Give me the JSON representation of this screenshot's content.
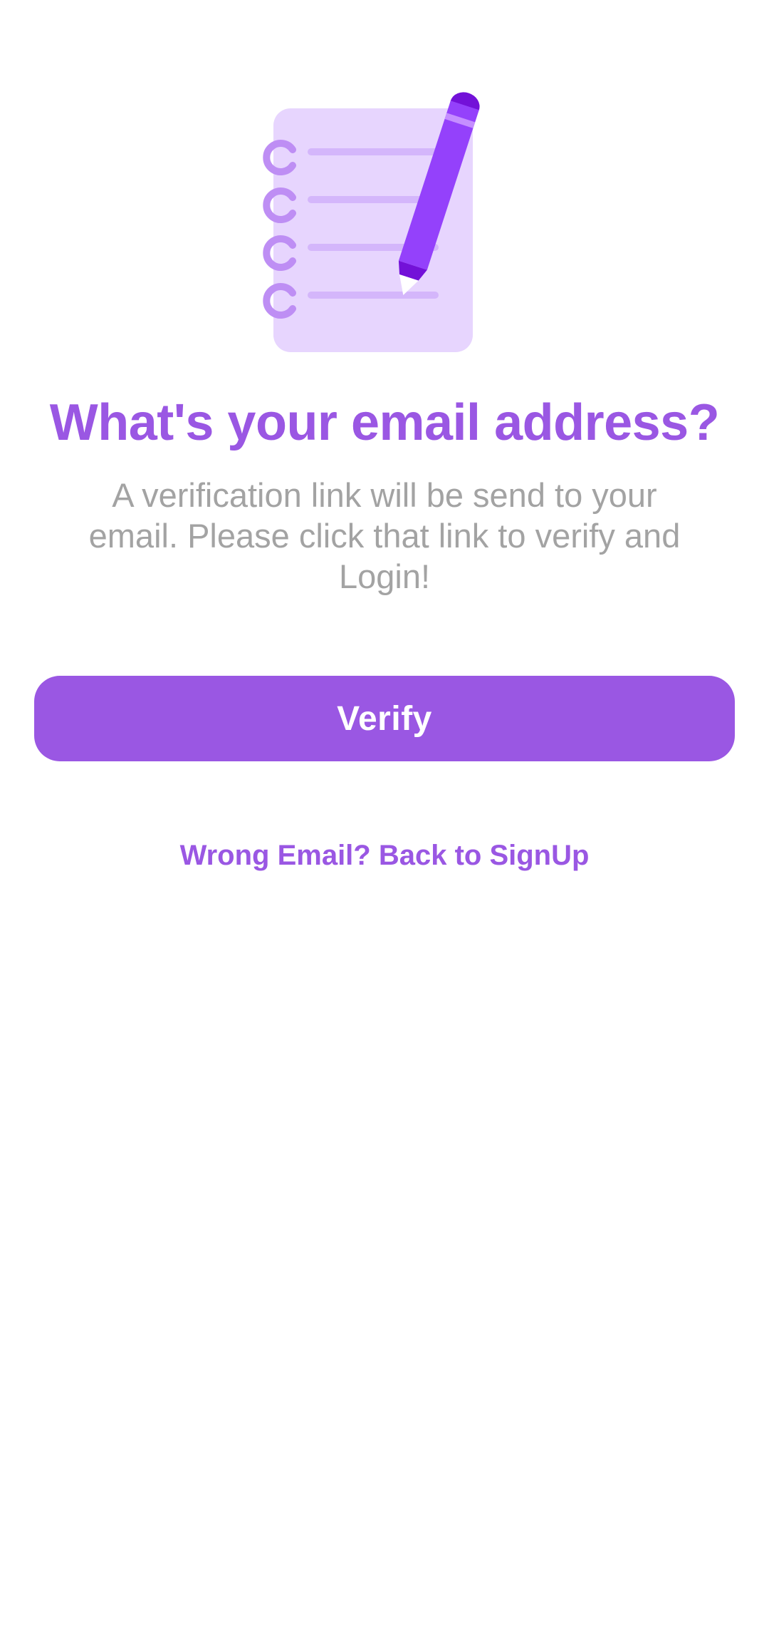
{
  "colors": {
    "accent": "#9A57E3",
    "subtitle_text": "#A3A3A3",
    "background": "#FFFFFF",
    "notepad_fill": "#E7D5FE",
    "notepad_lines": "#D4B6FB",
    "ring": "#BE8EF4",
    "pencil_body": "#9441FB",
    "pencil_dark": "#7311D8",
    "pencil_band": "#C58EFF",
    "button_text": "#FFFFFF"
  },
  "illustration": {
    "icon": "notepad-with-pencil-icon"
  },
  "screen": {
    "title": "What's your email address?",
    "subtitle": "A verification link will be send to your email. Please click that link to verify and Login!",
    "verify_label": "Verify",
    "back_link_label": "Wrong Email? Back to SignUp"
  }
}
